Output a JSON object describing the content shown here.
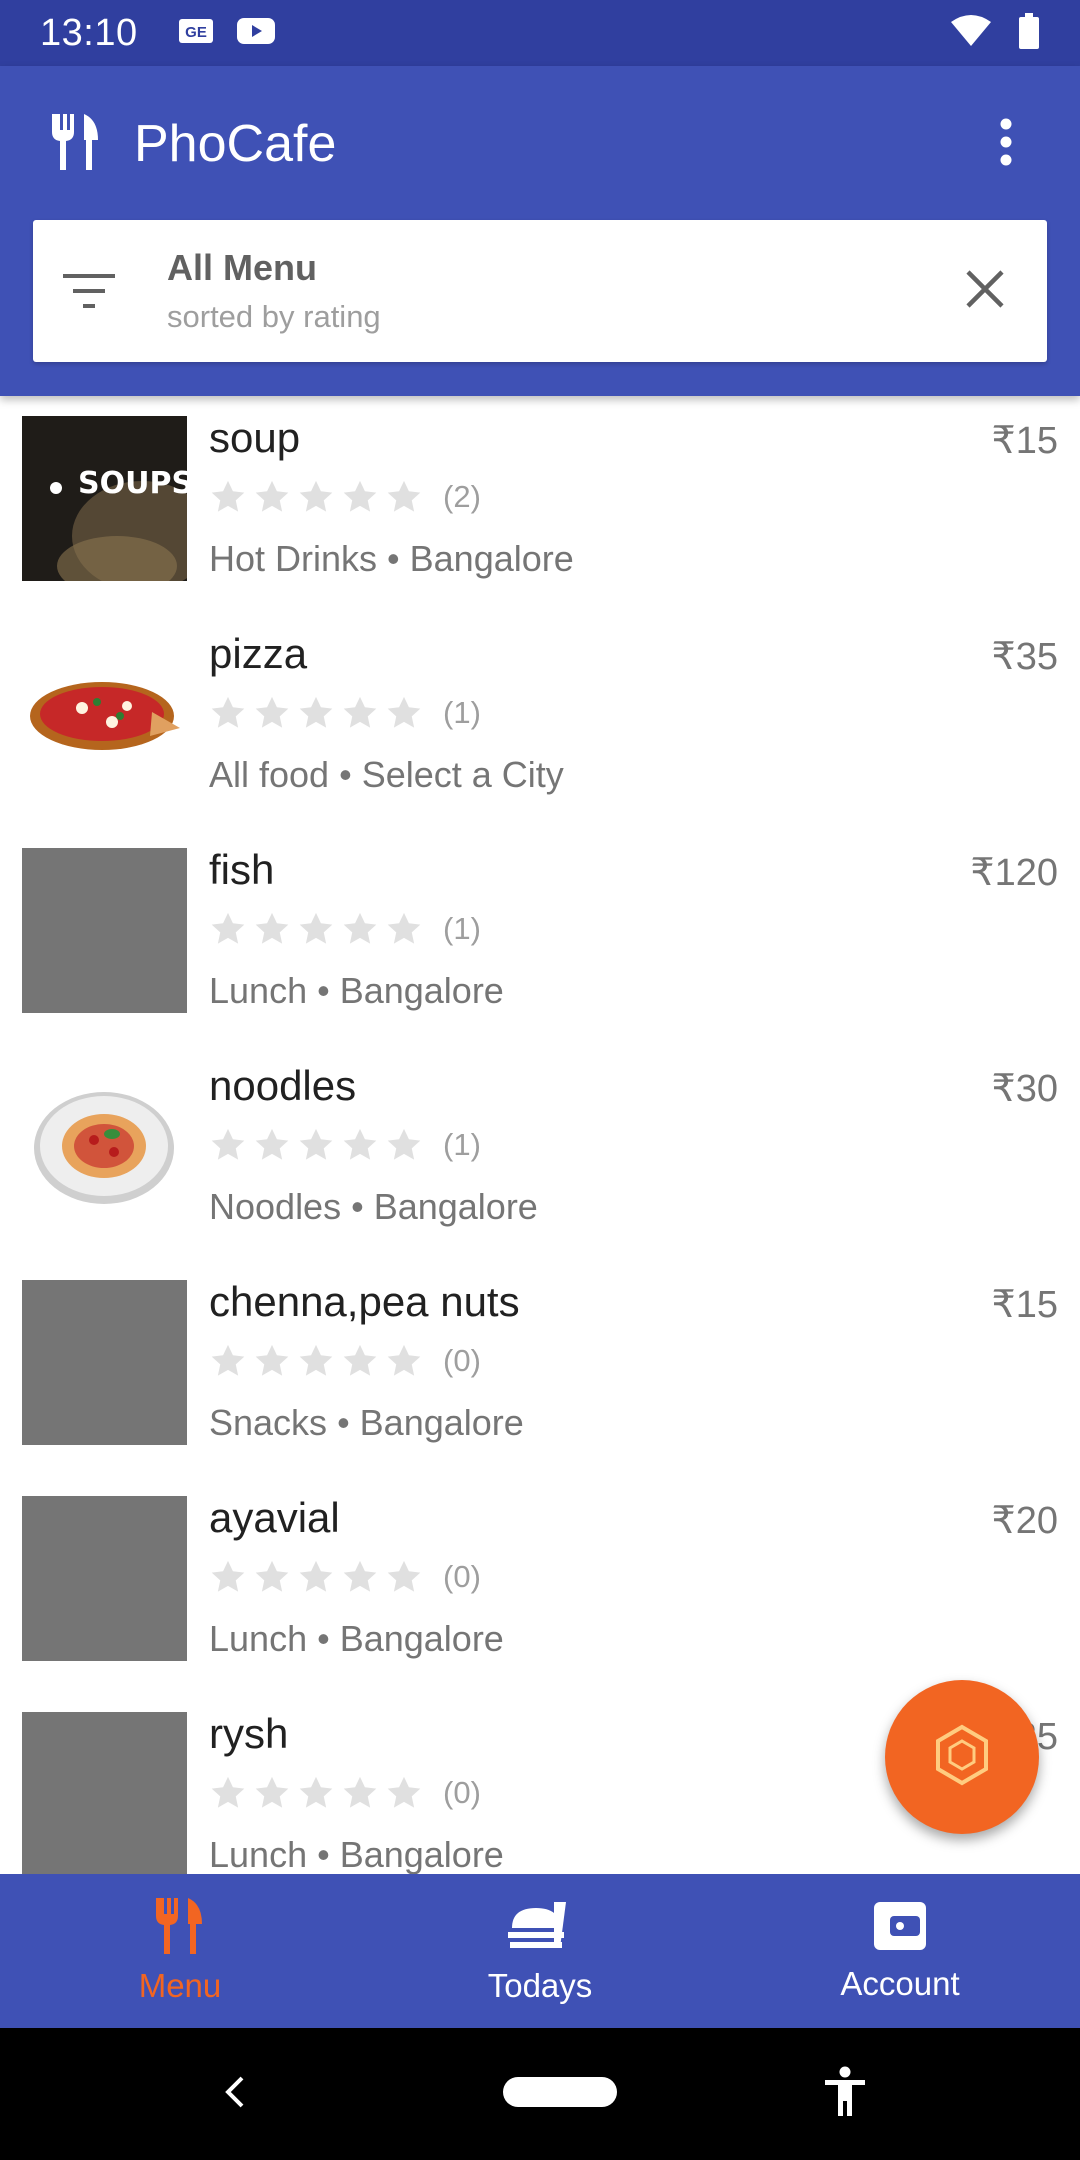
{
  "status_bar": {
    "time": "13:10",
    "left_icons": [
      "news-icon",
      "youtube-icon"
    ],
    "right_icons": [
      "wifi-icon",
      "battery-icon"
    ]
  },
  "app_bar": {
    "title": "PhoCafe",
    "logo_icon": "fork-knife-icon",
    "overflow_icon": "more-vert-icon"
  },
  "filter": {
    "title": "All Menu",
    "subtitle": "sorted by rating",
    "filter_icon": "filter-list-icon",
    "clear_icon": "close-icon"
  },
  "menu_items": [
    {
      "name": "soup",
      "price": "₹15",
      "rating_count": "(2)",
      "category": "Hot Drinks",
      "city": "Bangalore",
      "image": "soups-photo",
      "image_text": "SOUPS"
    },
    {
      "name": "pizza",
      "price": "₹35",
      "rating_count": "(1)",
      "category": "All food",
      "city": "Select a City",
      "image": "pizza-photo"
    },
    {
      "name": "fish",
      "price": "₹120",
      "rating_count": "(1)",
      "category": "Lunch",
      "city": "Bangalore",
      "image": "placeholder"
    },
    {
      "name": "noodles",
      "price": "₹30",
      "rating_count": "(1)",
      "category": "Noodles",
      "city": "Bangalore",
      "image": "noodles-photo"
    },
    {
      "name": "chenna,pea nuts",
      "price": "₹15",
      "rating_count": "(0)",
      "category": "Snacks",
      "city": "Bangalore",
      "image": "placeholder"
    },
    {
      "name": "ayavial",
      "price": "₹20",
      "rating_count": "(0)",
      "category": "Lunch",
      "city": "Bangalore",
      "image": "placeholder"
    },
    {
      "name": "rysh",
      "price": "₹25",
      "rating_count": "(0)",
      "category": "Lunch",
      "city": "Bangalore",
      "image": "placeholder"
    }
  ],
  "rating_stars": 5,
  "fab": {
    "icon": "hexagon-icon"
  },
  "bottom_nav": [
    {
      "label": "Menu",
      "icon": "fork-knife-icon",
      "active": true
    },
    {
      "label": "Todays",
      "icon": "food-serving-icon",
      "active": false
    },
    {
      "label": "Account",
      "icon": "wallet-icon",
      "active": false
    }
  ],
  "system_nav": [
    "back-icon",
    "home-pill-icon",
    "accessibility-icon"
  ],
  "colors": {
    "primary": "#3f51b5",
    "primary_dark": "#303f9f",
    "accent": "#f26522",
    "star_empty": "#e0e0e0",
    "placeholder": "#757575"
  }
}
